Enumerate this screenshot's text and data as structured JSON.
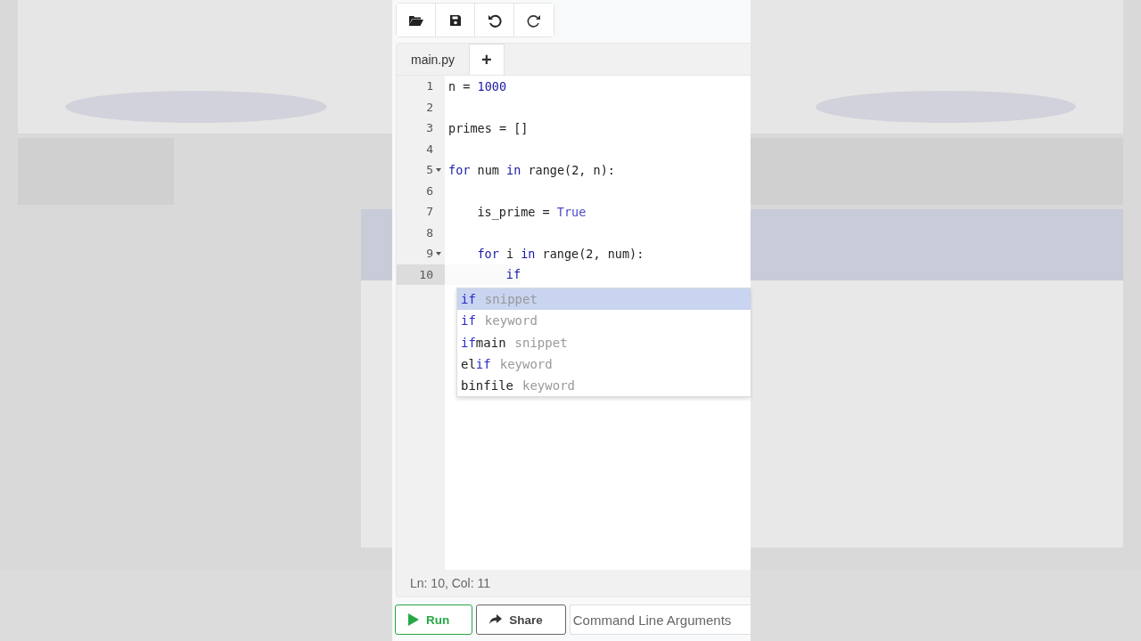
{
  "toolbar": {
    "buttons": [
      {
        "kind": "open"
      },
      {
        "kind": "save"
      },
      {
        "kind": "undo"
      },
      {
        "kind": "redo"
      }
    ]
  },
  "tabs": [
    {
      "label": "main.py",
      "kind": "file",
      "selected": true
    },
    {
      "label": "+",
      "kind": "add",
      "selected": false
    }
  ],
  "editor": {
    "lines": [
      {
        "number": "1",
        "foldable": false,
        "active": false,
        "kind": "top",
        "tokens": [
          {
            "text": "n = ",
            "kind": "plain"
          },
          {
            "text": "1000",
            "kind": "number"
          }
        ]
      },
      {
        "number": "2",
        "foldable": false,
        "active": false
      },
      {
        "number": "3",
        "foldable": false,
        "active": false,
        "kind": "top",
        "tokens": [
          {
            "text": "primes = []",
            "kind": "plain"
          }
        ]
      },
      {
        "number": "4",
        "foldable": false,
        "active": false
      },
      {
        "number": "5",
        "foldable": true,
        "active": false,
        "kind": "top",
        "tokens": [
          {
            "text": "for",
            "kind": "keyword"
          },
          {
            "text": " num ",
            "kind": "plain"
          },
          {
            "text": "in",
            "kind": "keyword"
          },
          {
            "text": " range(2, n):",
            "kind": "plain"
          }
        ]
      },
      {
        "number": "6",
        "foldable": false,
        "active": false
      },
      {
        "number": "7",
        "foldable": false,
        "active": false,
        "kind": "inner",
        "tokens": [
          {
            "text": "is_prime = ",
            "kind": "plain"
          },
          {
            "text": "True",
            "kind": "constant"
          }
        ]
      },
      {
        "number": "8",
        "foldable": false,
        "active": false
      },
      {
        "number": "9",
        "foldable": true,
        "active": false,
        "kind": "inner",
        "tokens": [
          {
            "text": "for",
            "kind": "keyword"
          },
          {
            "text": " i ",
            "kind": "plain"
          },
          {
            "text": "in",
            "kind": "keyword"
          },
          {
            "text": " range(2, num):",
            "kind": "plain"
          }
        ]
      },
      {
        "number": "10",
        "foldable": false,
        "active": true,
        "kind": "innermost",
        "tokens": [
          {
            "text": "if",
            "kind": "keyword"
          }
        ]
      }
    ],
    "completions": [
      {
        "label": "**if**",
        "meta": "snippet",
        "selected": true
      },
      {
        "label": "**if**",
        "meta": "keyword",
        "selected": false
      },
      {
        "label": "**if**main",
        "meta": "snippet",
        "selected": false
      },
      {
        "label": "el**if**",
        "meta": "keyword",
        "selected": false
      },
      {
        "label": "binfile",
        "meta": "keyword",
        "selected": false
      }
    ]
  },
  "status_bar": {
    "position": "Ln: 10,  Col: 11"
  },
  "actions": [
    {
      "label": "Run",
      "kind": "run"
    },
    {
      "label": "Share",
      "kind": "share"
    }
  ],
  "arguments_field": {
    "placeholder": "Command Line Arguments"
  }
}
